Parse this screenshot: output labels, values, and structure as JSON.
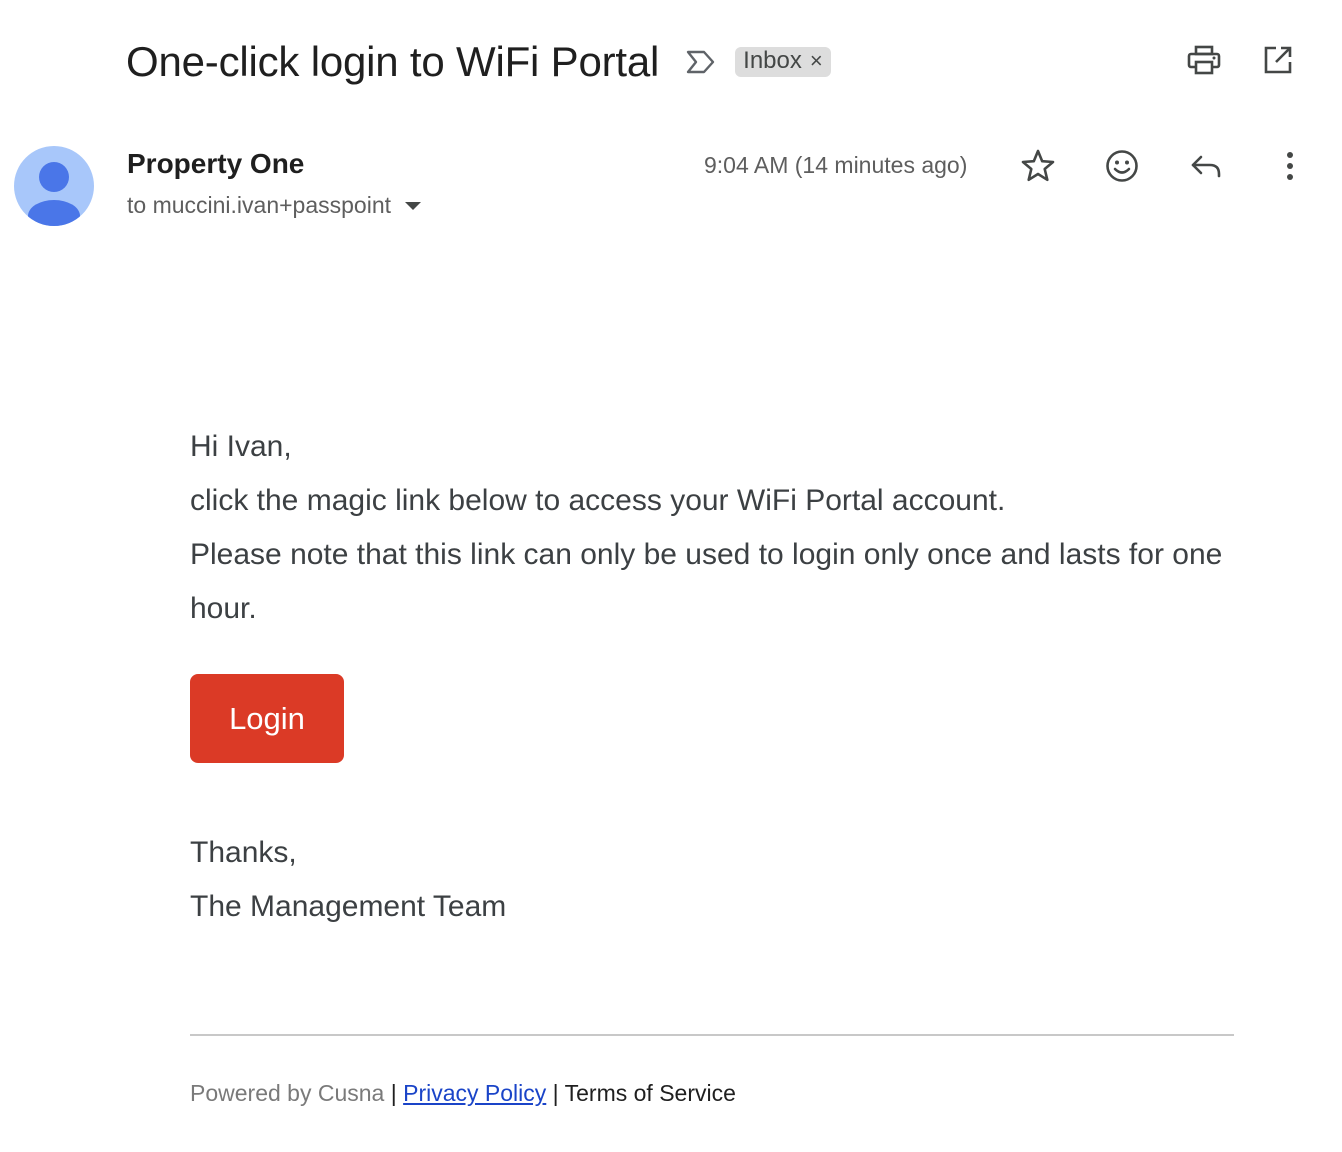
{
  "header": {
    "subject": "One-click login to WiFi Portal",
    "label": "Inbox",
    "label_remove": "×"
  },
  "sender": {
    "name": "Property One",
    "recipient": "to muccini.ivan+passpoint",
    "timestamp": "9:04 AM (14 minutes ago)"
  },
  "body": {
    "greeting": "Hi Ivan,",
    "line1": "click the magic link below to access your WiFi Portal account.",
    "line2": "Please note that this link can only be used to login only once and lasts for one hour.",
    "button": "Login",
    "thanks": "Thanks,",
    "team": "The Management Team"
  },
  "footer": {
    "powered": "Powered by Cusna",
    "sep": "|",
    "privacy": "Privacy Policy",
    "terms": "Terms of Service"
  },
  "colors": {
    "button": "#db3a26",
    "avatar_bg": "#a8c7fa",
    "avatar_fg": "#4a76e8",
    "link": "#1a44c8"
  },
  "icons": {
    "important": "importance-marker-icon",
    "print": "print-icon",
    "open_new": "open-in-new-window-icon",
    "star": "star-icon",
    "emoji": "emoji-reaction-icon",
    "reply": "reply-icon",
    "more": "more-vertical-icon",
    "dropdown": "caret-down-icon"
  }
}
